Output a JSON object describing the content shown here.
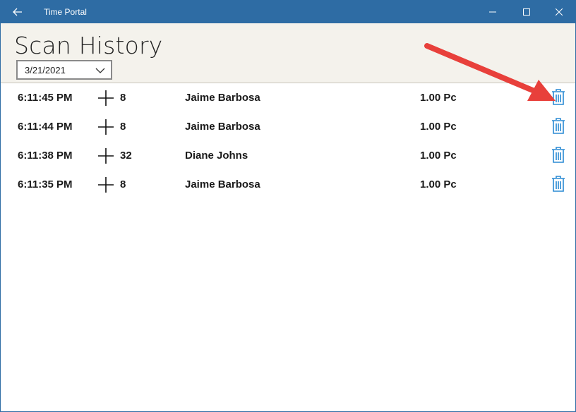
{
  "window": {
    "title": "Time Portal",
    "accent": "#2e6ca4"
  },
  "header": {
    "title": "Scan History",
    "date_selected": "3/21/2021"
  },
  "rows": [
    {
      "time": "6:11:45 PM",
      "count": "8",
      "name": "Jaime Barbosa",
      "qty": "1.00 Pc"
    },
    {
      "time": "6:11:44 PM",
      "count": "8",
      "name": "Jaime Barbosa",
      "qty": "1.00 Pc"
    },
    {
      "time": "6:11:38 PM",
      "count": "32",
      "name": "Diane Johns",
      "qty": "1.00 Pc"
    },
    {
      "time": "6:11:35 PM",
      "count": "8",
      "name": "Jaime Barbosa",
      "qty": "1.00 Pc"
    }
  ],
  "icons": {
    "back": "back-arrow-icon",
    "add": "plus-icon",
    "delete": "trash-icon"
  },
  "colors": {
    "delete_icon": "#2a8ad4",
    "annotation_arrow": "#e8403b"
  }
}
